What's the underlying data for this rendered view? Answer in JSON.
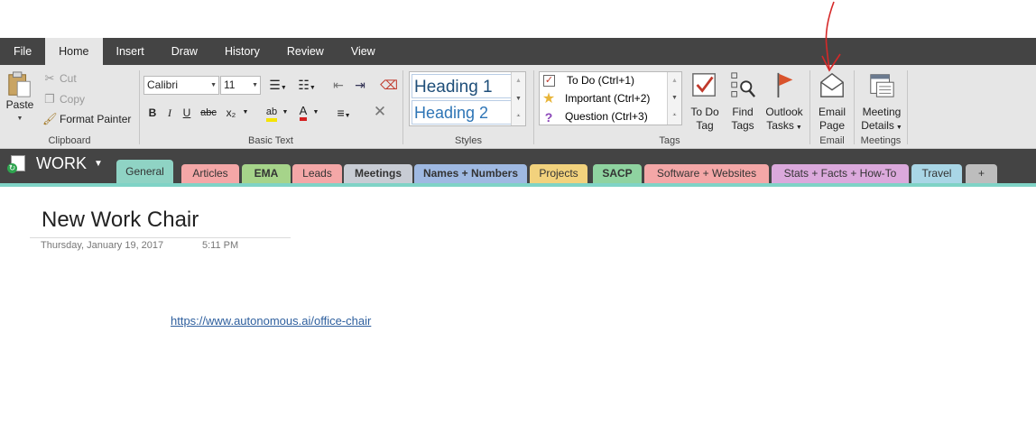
{
  "menu": {
    "tabs": [
      {
        "label": "File"
      },
      {
        "label": "Home"
      },
      {
        "label": "Insert"
      },
      {
        "label": "Draw"
      },
      {
        "label": "History"
      },
      {
        "label": "Review"
      },
      {
        "label": "View"
      }
    ],
    "active": "Home"
  },
  "ribbon": {
    "clipboard": {
      "paste": "Paste",
      "cut": "Cut",
      "copy": "Copy",
      "format_painter": "Format Painter",
      "label": "Clipboard"
    },
    "basic_text": {
      "font": "Calibri",
      "size": "11",
      "bold": "B",
      "italic": "I",
      "underline": "U",
      "strike": "abc",
      "subscript": "x₂",
      "label": "Basic Text"
    },
    "styles": {
      "heading1": "Heading 1",
      "heading2": "Heading 2",
      "label": "Styles"
    },
    "tags": {
      "items": [
        {
          "label": "To Do (Ctrl+1)",
          "icon": "checkbox-icon"
        },
        {
          "label": "Important (Ctrl+2)",
          "icon": "star-icon"
        },
        {
          "label": "Question (Ctrl+3)",
          "icon": "question-icon"
        }
      ],
      "todo_l1": "To Do",
      "todo_l2": "Tag",
      "find_l1": "Find",
      "find_l2": "Tags",
      "outlook_l1": "Outlook",
      "outlook_l2": "Tasks",
      "label": "Tags"
    },
    "email": {
      "l1": "Email",
      "l2": "Page",
      "label": "Email"
    },
    "meetings": {
      "l1": "Meeting",
      "l2": "Details",
      "label": "Meetings"
    }
  },
  "notebook": {
    "name": "WORK"
  },
  "sections": [
    {
      "label": "General",
      "color": "#8fd3c4",
      "bold": false
    },
    {
      "label": "Articles",
      "color": "#f4a7a7",
      "bold": false
    },
    {
      "label": "EMA",
      "color": "#a6d48a",
      "bold": true
    },
    {
      "label": "Leads",
      "color": "#f4a7a7",
      "bold": false
    },
    {
      "label": "Meetings",
      "color": "#c8ccd4",
      "bold": true
    },
    {
      "label": "Names + Numbers",
      "color": "#9fb9e2",
      "bold": true
    },
    {
      "label": "Projects",
      "color": "#f2d27d",
      "bold": false
    },
    {
      "label": "SACP",
      "color": "#8fd3a0",
      "bold": true
    },
    {
      "label": "Software + Websites",
      "color": "#f4a7a7",
      "bold": false
    },
    {
      "label": "Stats + Facts + How-To",
      "color": "#dba9dc",
      "bold": false
    },
    {
      "label": "Travel",
      "color": "#a9d6e6",
      "bold": false
    },
    {
      "label": "+",
      "color": "#bdbdbd",
      "bold": false
    }
  ],
  "page": {
    "title": "New Work Chair",
    "date": "Thursday, January 19, 2017",
    "time": "5:11 PM",
    "link": "https://www.autonomous.ai/office-chair"
  },
  "colors": {
    "menubar": "#444444",
    "ribbon": "#e6e6e6",
    "accent": "#7fd3c6",
    "annotation": "#d62828"
  }
}
